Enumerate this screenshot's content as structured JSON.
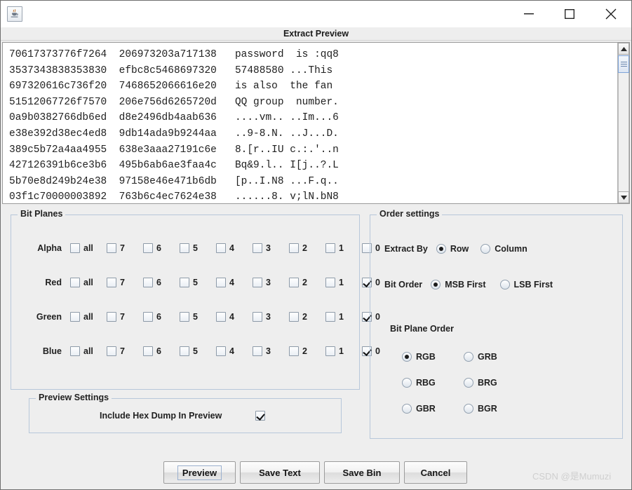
{
  "window": {
    "title": "Extract Preview",
    "icon": "java-cup-icon",
    "controls": {
      "minimize": "minimize-icon",
      "maximize": "maximize-icon",
      "close": "close-icon"
    }
  },
  "preview": {
    "lines": [
      "70617373776f7264  206973203a717138   password  is :qq8",
      "3537343838353830  efbc8c5468697320   57488580 ...This",
      "697320616c736f20  7468652066616e20   is also  the fan",
      "51512067726f7570  206e756d6265720d   QQ group  number.",
      "0a9b0382766db6ed  d8e2496db4aab636   ....vm.. ..Im...6",
      "e38e392d38ec4ed8  9db14ada9b9244aa   ..9-8.N. ..J...D.",
      "389c5b72a4aa4955  638e3aaa27191c6e   8.[r..IU c.:.'..n",
      "427126391b6ce3b6  495b6ab6ae3faa4c   Bq&9.l.. I[j..?.L",
      "5b70e8d249b24e38  97158e46e471b6db   [p..I.N8 ...F.q..",
      "03f1c70000003892  763b6c4ec7624e38   ......8. v;lN.bN8"
    ],
    "scrollbar": {
      "up": "scroll-up-arrow-icon",
      "down": "scroll-down-arrow-icon"
    }
  },
  "bit_planes": {
    "title": "Bit Planes",
    "columns": [
      "all",
      "7",
      "6",
      "5",
      "4",
      "3",
      "2",
      "1",
      "0"
    ],
    "rows": [
      {
        "label": "Alpha",
        "checked": [
          false,
          false,
          false,
          false,
          false,
          false,
          false,
          false,
          false
        ]
      },
      {
        "label": "Red",
        "checked": [
          false,
          false,
          false,
          false,
          false,
          false,
          false,
          false,
          true
        ]
      },
      {
        "label": "Green",
        "checked": [
          false,
          false,
          false,
          false,
          false,
          false,
          false,
          false,
          true
        ]
      },
      {
        "label": "Blue",
        "checked": [
          false,
          false,
          false,
          false,
          false,
          false,
          false,
          false,
          true
        ]
      }
    ]
  },
  "order_settings": {
    "title": "Order settings",
    "extract_by": {
      "label": "Extract By",
      "options": [
        "Row",
        "Column"
      ],
      "selected": "Row"
    },
    "bit_order": {
      "label": "Bit Order",
      "options": [
        "MSB First",
        "LSB First"
      ],
      "selected": "MSB First"
    },
    "bit_plane_order": {
      "label": "Bit Plane Order",
      "options": [
        "RGB",
        "GRB",
        "RBG",
        "BRG",
        "GBR",
        "BGR"
      ],
      "selected": "RGB"
    }
  },
  "preview_settings": {
    "title": "Preview Settings",
    "include_hex_dump": {
      "label": "Include Hex Dump In Preview",
      "checked": true
    }
  },
  "buttons": {
    "preview": "Preview",
    "save_text": "Save Text",
    "save_bin": "Save Bin",
    "cancel": "Cancel"
  },
  "watermark": "CSDN @是Mumuzi",
  "colors": {
    "panel_bg": "#eeeeee",
    "group_border": "#b7c7da",
    "text": "#1f1f1f",
    "scroll_thumb": "#7ea3d8"
  }
}
